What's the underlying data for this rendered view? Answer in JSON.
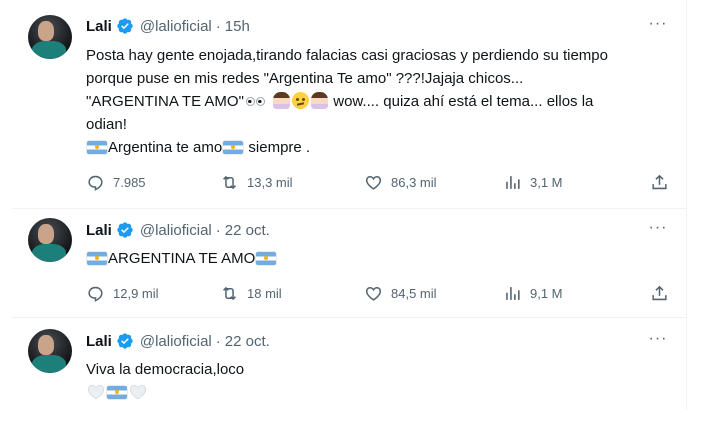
{
  "tweets": [
    {
      "author": {
        "name": "Lali",
        "handle": "@lalioficial",
        "verified": true
      },
      "time": "15h",
      "lines": [
        "Posta hay gente enojada,tirando falacias casi graciosas y perdiendo su tiempo",
        "porque puse en mis redes \"Argentina Te amo\" ???!Jajaja chicos...",
        {
          "before": "\"ARGENTINA TE AMO\"",
          "after": " wow.... quiza ahí está el tema... ellos la"
        },
        "odian!",
        {
          "text1": "Argentina te amo",
          "text2": " siempre ."
        }
      ],
      "emojis": [
        "eyes",
        "person-facepalming",
        "face-with-rolling-eyes",
        "person-facepalming",
        "flag-argentina",
        "flag-argentina"
      ],
      "stats": {
        "replies": "7.985",
        "retweets": "13,3 mil",
        "likes": "86,3 mil",
        "views": "3,1 M"
      }
    },
    {
      "author": {
        "name": "Lali",
        "handle": "@lalioficial",
        "verified": true
      },
      "time": "22 oct.",
      "text": "ARGENTINA TE AMO",
      "emojis": [
        "flag-argentina",
        "flag-argentina"
      ],
      "stats": {
        "replies": "12,9 mil",
        "retweets": "18 mil",
        "likes": "84,5 mil",
        "views": "9,1 M"
      }
    },
    {
      "author": {
        "name": "Lali",
        "handle": "@lalioficial",
        "verified": true
      },
      "time": "22 oct.",
      "text": "Viva la democracia,loco",
      "emojis": [
        "white-heart",
        "flag-argentina",
        "white-heart"
      ]
    }
  ],
  "ui": {
    "dot": "·",
    "more_glyph": "···",
    "icons": [
      "more-icon",
      "verified-badge-icon",
      "reply-icon",
      "retweet-icon",
      "like-icon",
      "views-icon",
      "share-icon"
    ]
  },
  "colors": {
    "verified": "#1d9bf0",
    "secondary_text": "#536471",
    "divider": "#eff3f4"
  }
}
